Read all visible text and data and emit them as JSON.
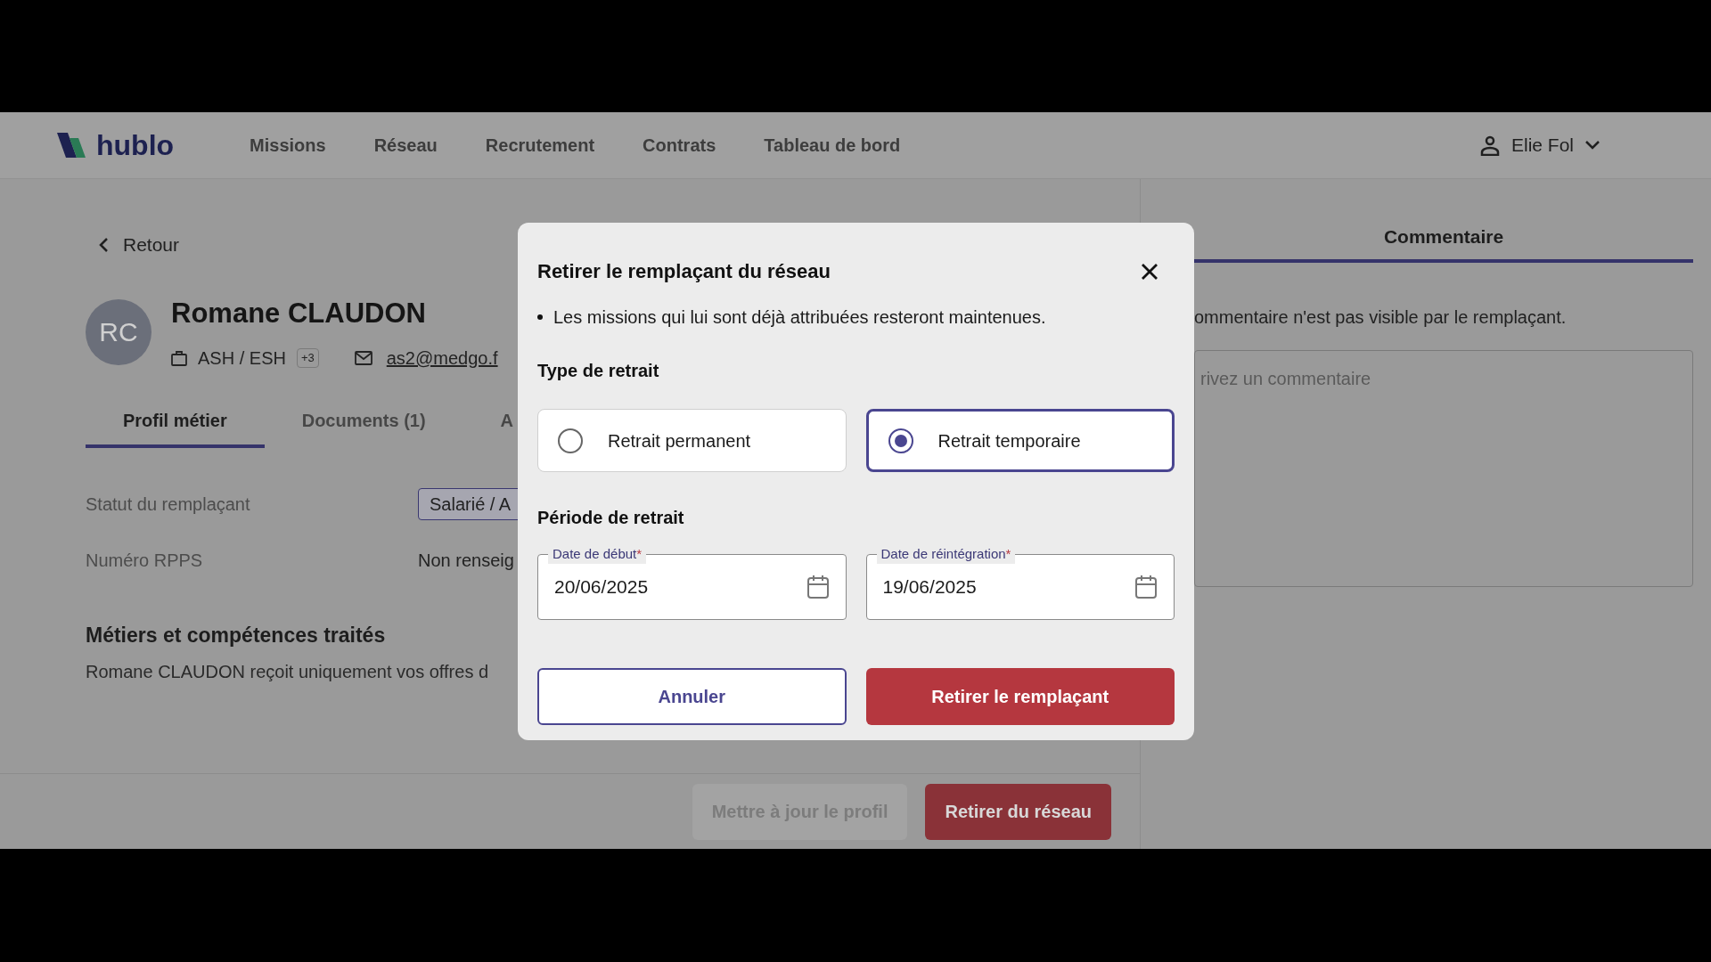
{
  "header": {
    "logo": "hublo",
    "nav": [
      {
        "label": "Missions"
      },
      {
        "label": "Réseau"
      },
      {
        "label": "Recrutement"
      },
      {
        "label": "Contrats"
      },
      {
        "label": "Tableau de bord"
      }
    ],
    "user": "Elie Fol"
  },
  "profile": {
    "back": "Retour",
    "initials": "RC",
    "name": "Romane CLAUDON",
    "job": "ASH / ESH",
    "job_more": "+3",
    "email": "as2@medgo.f",
    "tabs": [
      {
        "label": "Profil métier",
        "selected": true
      },
      {
        "label": "Documents (1)",
        "selected": false
      },
      {
        "label": "A",
        "selected": false
      }
    ],
    "fields": [
      {
        "label": "Statut du remplaçant",
        "value": "Salarié / A",
        "kind": "tag"
      },
      {
        "label": "Numéro RPPS",
        "value": "Non renseig",
        "kind": "text"
      }
    ],
    "section_title": "Métiers et compétences traités",
    "section_text": "Romane CLAUDON reçoit uniquement vos offres d",
    "actions": [
      {
        "label": "Mettre à jour le profil",
        "kind": "secondary"
      },
      {
        "label": "Retirer du réseau",
        "kind": "danger"
      }
    ]
  },
  "comment": {
    "tab": "Commentaire",
    "note": "ommentaire n'est pas visible par le remplaçant.",
    "placeholder": "rivez un commentaire"
  },
  "dialog": {
    "title": "Retirer le remplaçant du réseau",
    "bullet": "Les missions qui lui sont déjà attribuées resteront maintenues.",
    "type_label": "Type de retrait",
    "options": [
      {
        "label": "Retrait permanent",
        "selected": false
      },
      {
        "label": "Retrait temporaire",
        "selected": true
      }
    ],
    "period_label": "Période de retrait",
    "dates": [
      {
        "label": "Date de début",
        "value": "20/06/2025"
      },
      {
        "label": "Date de réintégration",
        "value": "19/06/2025"
      }
    ],
    "required_mark": "*",
    "cancel": "Annuler",
    "confirm": "Retirer le remplaçant"
  }
}
